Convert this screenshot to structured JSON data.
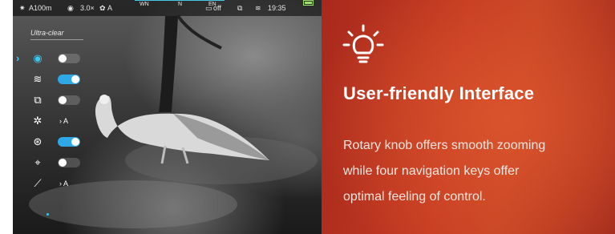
{
  "statusbar": {
    "range": "A100m",
    "zoom": "3.0×",
    "auto_mode": "A",
    "compass": {
      "west": "WN",
      "north": "N",
      "east": "EN"
    },
    "record": "off",
    "time": "19:35"
  },
  "screen": {
    "mode_label": "Ultra-clear",
    "menu": [
      {
        "icon": "eye-icon",
        "glyph": "◉",
        "control": "toggle",
        "state": "off",
        "active": true
      },
      {
        "icon": "wifi-icon",
        "glyph": "≋",
        "control": "toggle",
        "state": "on",
        "active": false
      },
      {
        "icon": "picture-in-picture-icon",
        "glyph": "⧉",
        "control": "toggle",
        "state": "off",
        "active": false
      },
      {
        "icon": "aperture-icon",
        "glyph": "✲",
        "control": "value",
        "value": "› A",
        "active": false
      },
      {
        "icon": "compass-icon",
        "glyph": "⊛",
        "control": "toggle",
        "state": "on",
        "active": false
      },
      {
        "icon": "crosshair-icon",
        "glyph": "⌖",
        "control": "toggle",
        "state": "off",
        "active": false
      },
      {
        "icon": "rifle-icon",
        "glyph": "⟋",
        "control": "value",
        "value": "› A",
        "active": false
      }
    ],
    "selection_marker": "›"
  },
  "panel": {
    "title": "User-friendly Interface",
    "description_lines": [
      "Rotary knob offers smooth zooming",
      "while four navigation keys offer",
      "optimal feeling of control."
    ],
    "icon": "lightbulb-icon"
  },
  "colors": {
    "accent_cyan": "#3dc8f0",
    "toggle_on": "#2fa8e8",
    "panel_red": "#c53b22",
    "battery_green": "#9ee06a"
  }
}
